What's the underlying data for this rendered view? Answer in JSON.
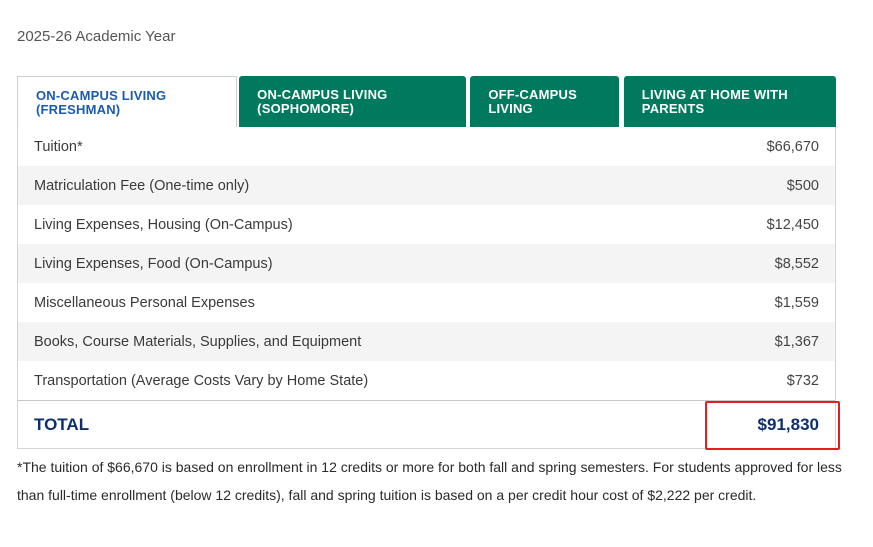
{
  "academic_year": "2025-26 Academic Year",
  "tabs": [
    {
      "label": "ON-CAMPUS LIVING (FRESHMAN)",
      "active": true
    },
    {
      "label": "ON-CAMPUS LIVING (SOPHOMORE)",
      "active": false
    },
    {
      "label": "OFF-CAMPUS LIVING",
      "active": false
    },
    {
      "label": "LIVING AT HOME WITH PARENTS",
      "active": false
    }
  ],
  "rows": [
    {
      "label": "Tuition*",
      "amount": "$66,670"
    },
    {
      "label": "Matriculation Fee (One-time only)",
      "amount": "$500"
    },
    {
      "label": "Living Expenses, Housing (On-Campus)",
      "amount": "$12,450"
    },
    {
      "label": "Living Expenses, Food (On-Campus)",
      "amount": "$8,552"
    },
    {
      "label": "Miscellaneous Personal Expenses",
      "amount": "$1,559"
    },
    {
      "label": "Books, Course Materials, Supplies, and Equipment",
      "amount": "$1,367"
    },
    {
      "label": "Transportation (Average Costs Vary by Home State)",
      "amount": "$732"
    }
  ],
  "total": {
    "label": "TOTAL",
    "amount": "$91,830"
  },
  "footnote": "*The tuition of $66,670 is based on enrollment in 12 credits or more for both fall and spring semesters. For students approved for less than full-time enrollment (below 12 credits), fall and spring tuition is based on a per credit hour cost of $2,222 per credit.",
  "colors": {
    "tab_active_text": "#1b5bb0",
    "tab_inactive_bg": "#007a5e",
    "total_text": "#0d2f6e",
    "highlight_border": "#e02020"
  }
}
